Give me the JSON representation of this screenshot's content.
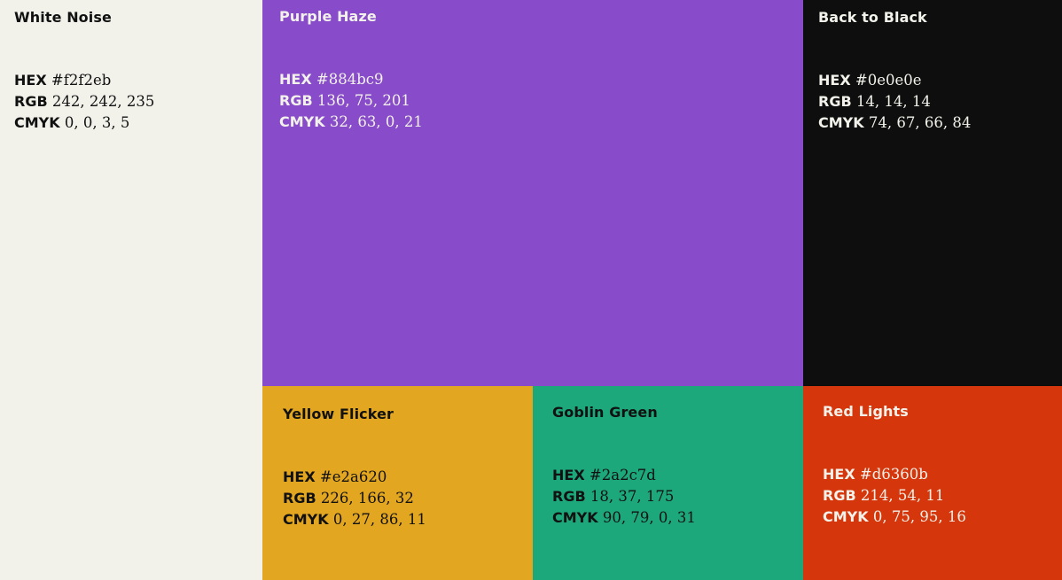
{
  "swatches": {
    "white": {
      "name": "White Noise",
      "hex_label": "HEX",
      "hex": "#f2f2eb",
      "rgb_label": "RGB",
      "rgb": "242, 242, 235",
      "cmyk_label": "CMYK",
      "cmyk": "0, 0, 3, 5",
      "color": "#f2f2eb"
    },
    "purple": {
      "name": "Purple Haze",
      "hex_label": "HEX",
      "hex": "#884bc9",
      "rgb_label": "RGB",
      "rgb": "136, 75, 201",
      "cmyk_label": "CMYK",
      "cmyk": "32, 63, 0, 21",
      "color": "#884bc9"
    },
    "black": {
      "name": "Back to Black",
      "hex_label": "HEX",
      "hex": "#0e0e0e",
      "rgb_label": "RGB",
      "rgb": "14, 14, 14",
      "cmyk_label": "CMYK",
      "cmyk": "74, 67, 66, 84",
      "color": "#0e0e0e"
    },
    "yellow": {
      "name": "Yellow Flicker",
      "hex_label": "HEX",
      "hex": "#e2a620",
      "rgb_label": "RGB",
      "rgb": "226, 166, 32",
      "cmyk_label": "CMYK",
      "cmyk": "0, 27, 86, 11",
      "color": "#e2a620"
    },
    "green": {
      "name": "Goblin Green",
      "hex_label": "HEX",
      "hex": "#2a2c7d",
      "rgb_label": "RGB",
      "rgb": "18, 37, 175",
      "cmyk_label": "CMYK",
      "cmyk": "90, 79, 0, 31",
      "color": "#1ca87b"
    },
    "red": {
      "name": "Red Lights",
      "hex_label": "HEX",
      "hex": "#d6360b",
      "rgb_label": "RGB",
      "rgb": "214, 54, 11",
      "cmyk_label": "CMYK",
      "cmyk": "0, 75, 95, 16",
      "color": "#d6360b"
    }
  }
}
